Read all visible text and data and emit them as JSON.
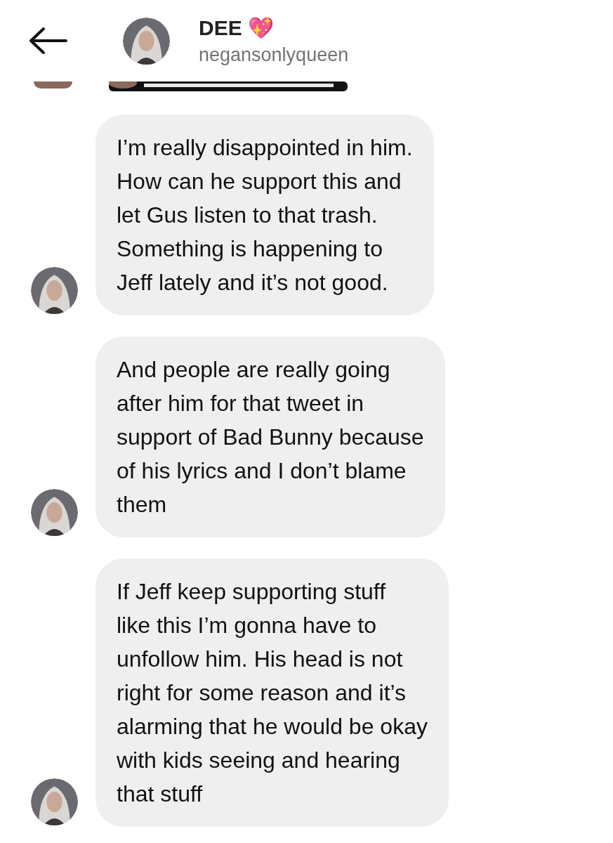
{
  "header": {
    "title": "DEE 💖",
    "username": "negansonlyqueen"
  },
  "messages": [
    {
      "text": "I’m really disappointed in him.\nHow can he support this and\nlet Gus listen to that trash.\nSomething is happening to\nJeff lately and it’s not good."
    },
    {
      "text": "And people are really going\nafter him for that tweet in\nsupport of Bad Bunny because\nof his lyrics and I don’t blame\nthem"
    },
    {
      "text": "If Jeff keep supporting stuff\nlike this I’m gonna have to\nunfollow him. His head is not\nright for some reason and it’s\nalarming that he would be okay\nwith kids seeing and hearing\nthat stuff"
    }
  ]
}
